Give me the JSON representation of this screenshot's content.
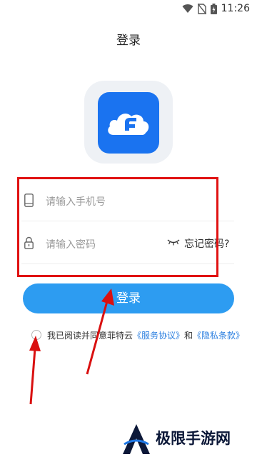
{
  "status_bar": {
    "time": "11:26"
  },
  "header": {
    "title": "登录"
  },
  "form": {
    "phone_placeholder": "请输入手机号",
    "password_placeholder": "请输入密码",
    "forgot_label": "忘记密码?"
  },
  "login_button": {
    "label": "登录"
  },
  "agreement": {
    "prefix": "我已阅读并同意菲特云",
    "service_link": "《服务协议》",
    "and": "和",
    "privacy_link": "《隐私条款》"
  },
  "watermark": {
    "text": "极限手游网"
  },
  "colors": {
    "accent": "#2d9cf1",
    "logo_blue": "#1a73f0",
    "annotation_red": "#e01212",
    "link_blue": "#2b7fe0"
  }
}
